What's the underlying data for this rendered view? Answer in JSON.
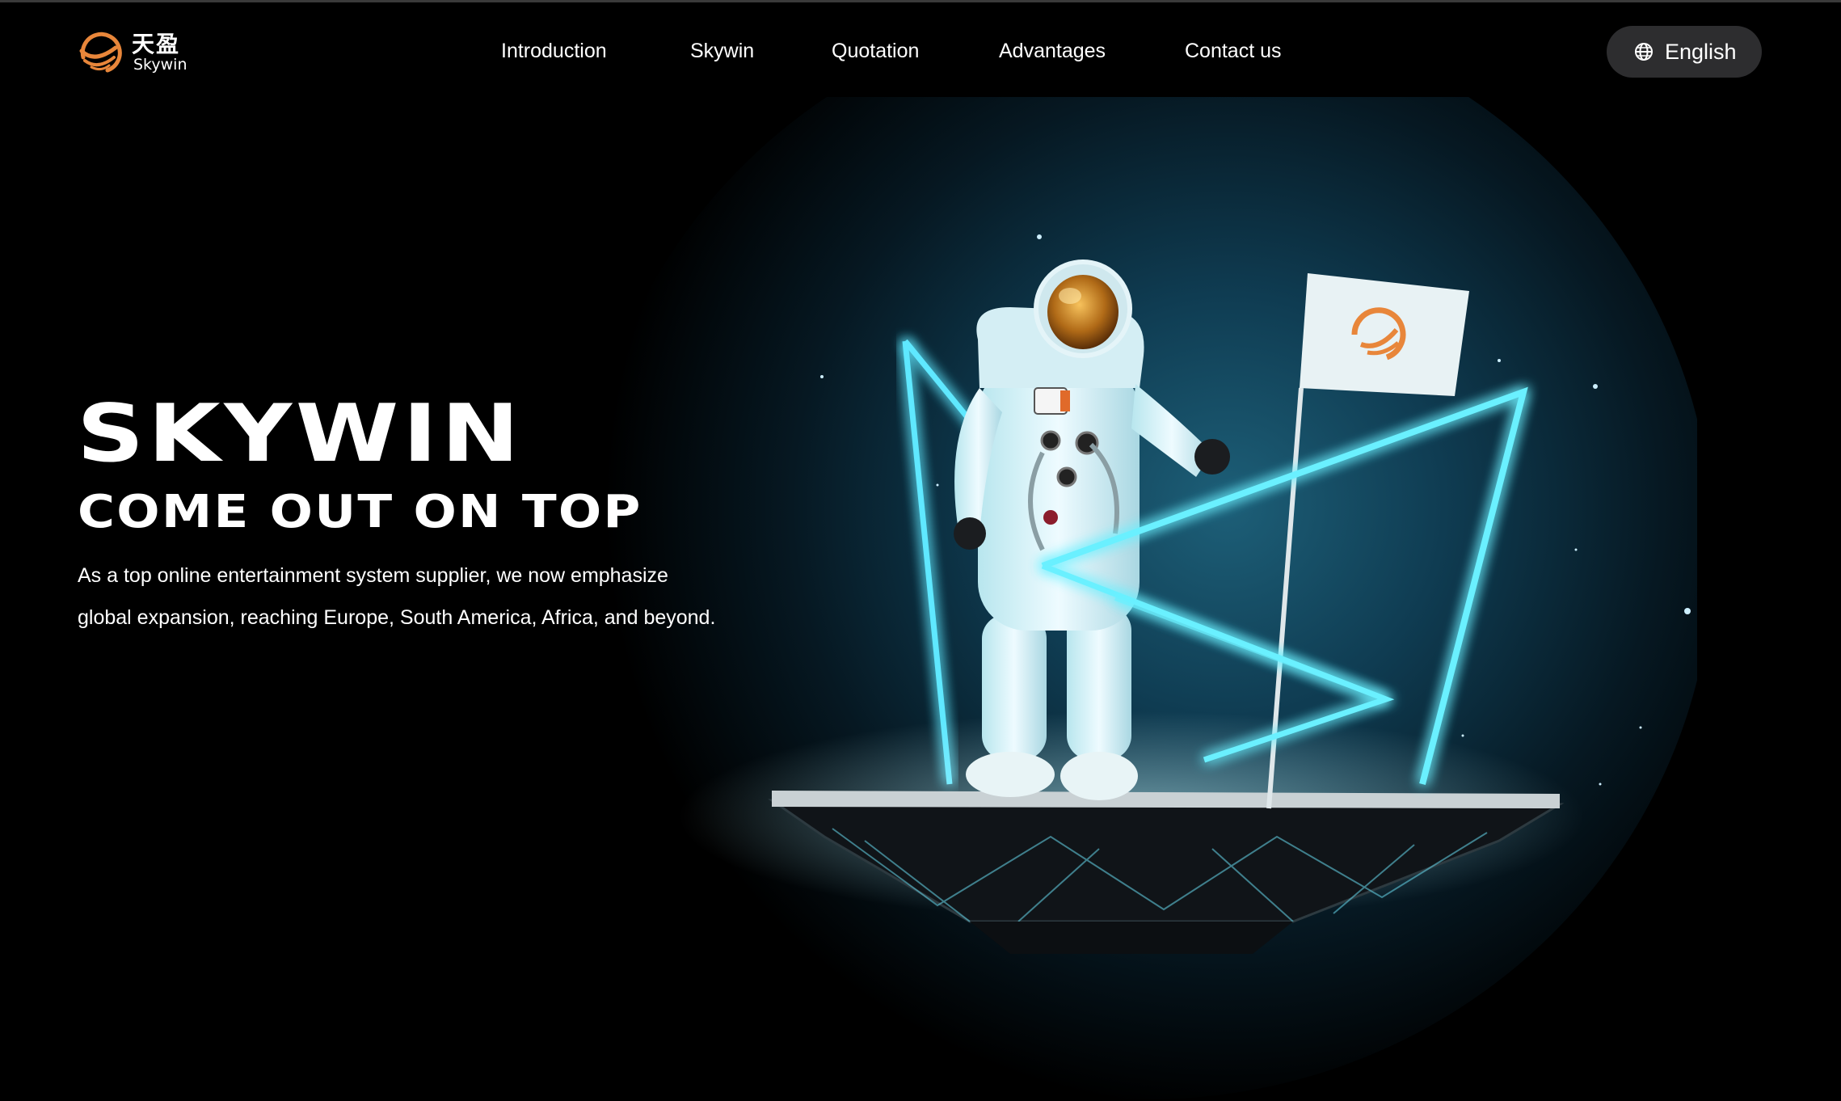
{
  "brand": {
    "name_cn": "天盈",
    "name_en": "Skywin",
    "accent_color": "#e8863a"
  },
  "nav": {
    "items": [
      {
        "label": "Introduction"
      },
      {
        "label": "Skywin"
      },
      {
        "label": "Quotation"
      },
      {
        "label": "Advantages"
      },
      {
        "label": "Contact us"
      }
    ]
  },
  "language": {
    "icon": "globe-icon",
    "label": "English"
  },
  "hero": {
    "title": "SKYWIN",
    "subtitle": "COME OUT ON TOP",
    "description": "As a top online entertainment system supplier, we now emphasize global expansion, reaching Europe, South America, Africa, and beyond.",
    "illustration": "astronaut-with-flag-on-floating-platform",
    "glow_color": "#3fe0ff"
  }
}
